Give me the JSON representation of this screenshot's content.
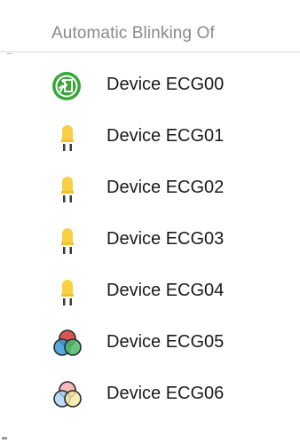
{
  "header": {
    "column_title": "Automatic Blinking Of"
  },
  "devices": [
    {
      "label": "Device ECG00",
      "icon": "emergency-exit-icon",
      "color": "#3aa63a"
    },
    {
      "label": "Device ECG01",
      "icon": "lamp-icon",
      "color": "#f7d046"
    },
    {
      "label": "Device ECG02",
      "icon": "lamp-icon",
      "color": "#f7d046"
    },
    {
      "label": "Device ECG03",
      "icon": "lamp-icon",
      "color": "#f7d046"
    },
    {
      "label": "Device ECG04",
      "icon": "lamp-icon",
      "color": "#f7d046"
    },
    {
      "label": "Device ECG05",
      "icon": "rgb-color-icon",
      "color": "#d94c4c"
    },
    {
      "label": "Device ECG06",
      "icon": "rgb-pastel-icon",
      "color": "#f4a9a9"
    }
  ]
}
